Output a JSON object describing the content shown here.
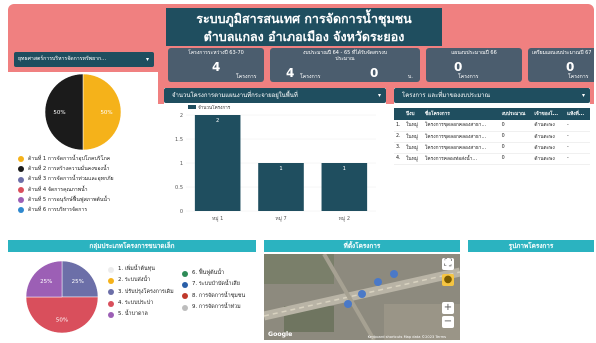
{
  "header": {
    "title_line1": "ระบบภูมิสารสนเทศ การจัดการน้ำชุมชน",
    "title_line2": "ตำบลแกลง อำเภอเมือง จังหวัดระยอง",
    "selector_label": "ยุทธศาสตร์การบริหารจัดการทรัพยาก..."
  },
  "kpis": [
    {
      "label": "โครงการระหว่างปี 63-70",
      "value": "4",
      "unit": "โครงการ"
    },
    {
      "label": "งบประมาณปี 64 - 65 ที่ได้รับจัดสรรงบประมาณ",
      "value": "4",
      "value2": "0",
      "unit": "โครงการ",
      "unit2": "บ."
    },
    {
      "label": "แผนงบประมาณปี 66",
      "value": "0",
      "unit": "โครงการ"
    },
    {
      "label": "เตรียมแผนงบประมาณปี 67",
      "value": "0",
      "unit": "โครงการ"
    }
  ],
  "pie1": {
    "slices": [
      {
        "label": "ด้านที่ 1 การจัดการน้ำอุปโภคบริโภค",
        "pct": 50,
        "color": "#f5b21a"
      },
      {
        "label": "ด้านที่ 2 การสร้างความมั่นคงของน้ำ",
        "pct": 50,
        "color": "#1b1b1b"
      }
    ],
    "legend": [
      {
        "label": "ด้านที่ 1 การจัดการน้ำอุปโภคบริโภค",
        "color": "#f5b21a"
      },
      {
        "label": "ด้านที่ 2 การสร้างความมั่นคงของน้ำ",
        "color": "#1b1b1b"
      },
      {
        "label": "ด้านที่ 3 การจัดการน้ำท่วมและอุทกภัย",
        "color": "#6c6fa8"
      },
      {
        "label": "ด้านที่ 4 จัดการคุณภาพน้ำ",
        "color": "#d94f5c"
      },
      {
        "label": "ด้านที่ 5 การอนุรักษ์ฟื้นฟูสภาพต้นน้ำ",
        "color": "#9c5fb5"
      },
      {
        "label": "ด้านที่ 6 การบริหารจัดการ",
        "color": "#2f89cf"
      }
    ]
  },
  "bar_panel": {
    "title": "จำนวนโครงการตามแผนงานที่กระจายอยู่ในพื้นที่"
  },
  "chart_data": {
    "type": "bar",
    "categories": [
      "หมู่ 1",
      "หมู่ 7",
      "หมู่ 2"
    ],
    "series": [
      {
        "name": "จำนวนโครงการ",
        "values": [
          2,
          1,
          1
        ],
        "color": "#1f4e5f"
      }
    ],
    "ylim": [
      0,
      2
    ],
    "yticks": [
      "0",
      "0.5",
      "1",
      "1.5",
      "2"
    ],
    "data_labels": [
      "2",
      "1",
      "1"
    ]
  },
  "table_panel": {
    "title": "โครงการ และที่มาของงบประมาณ",
    "columns": [
      "",
      "ปีงบ",
      "ชื่อโครงการ",
      "งบประมาณ",
      "เจ้าของโ...",
      "แห้งที่..."
    ],
    "rows": [
      [
        "1.",
        "ในหมู่",
        "โครงการขุดลอกคลองสาธา...",
        "0",
        "ด้านตะพง",
        "-"
      ],
      [
        "2.",
        "ในหมู่",
        "โครงการขุดลอกคลองสาธา...",
        "0",
        "ด้านตะพง",
        "-"
      ],
      [
        "3.",
        "ในหมู่",
        "โครงการขุดลอกคลองสาธา...",
        "0",
        "ด้านตะพง",
        "-"
      ],
      [
        "4.",
        "ในหมู่",
        "โครงการคลองท่อส่งน้ำ...",
        "0",
        "ด้านตะพง",
        "-"
      ]
    ]
  },
  "bottom": {
    "group_title": "กลุ่มประเภทโครงการขนาดเล็ก",
    "map_title": "ที่ตั้งโครงการ",
    "photo_title": "รูปภาพโครงการ"
  },
  "pie2": {
    "slices": [
      {
        "pct": 25,
        "color": "#6c6fa8"
      },
      {
        "pct": 50,
        "color": "#d94f5c"
      },
      {
        "pct": 25,
        "color": "#9c5fb5"
      }
    ],
    "legend_col1": [
      {
        "label": "1. เพิ่มน้ำต้นทุน",
        "color": "#ececec"
      },
      {
        "label": "2. ระบบส่งน้ำ",
        "color": "#f5b21a"
      },
      {
        "label": "3. ปรับปรุงโครงการเดิม",
        "color": "#6c6fa8"
      },
      {
        "label": "4. ระบบประปา",
        "color": "#d94f5c"
      },
      {
        "label": "5. น้ำบาดาล",
        "color": "#9c5fb5"
      }
    ],
    "legend_col2": [
      {
        "label": "6. ฟื้นฟูต้นน้ำ",
        "color": "#2e8b57"
      },
      {
        "label": "7. ระบบบำบัดน้ำเสีย",
        "color": "#2a5fa8"
      },
      {
        "label": "8. การจัดการน้ำชุมชน",
        "color": "#c0392b"
      },
      {
        "label": "9. การจัดการน้ำท่วม",
        "color": "#bdbdbd"
      }
    ]
  },
  "map": {
    "logo": "Google",
    "footer": "Keyboard shortcuts  Map data ©2023  Terms"
  }
}
